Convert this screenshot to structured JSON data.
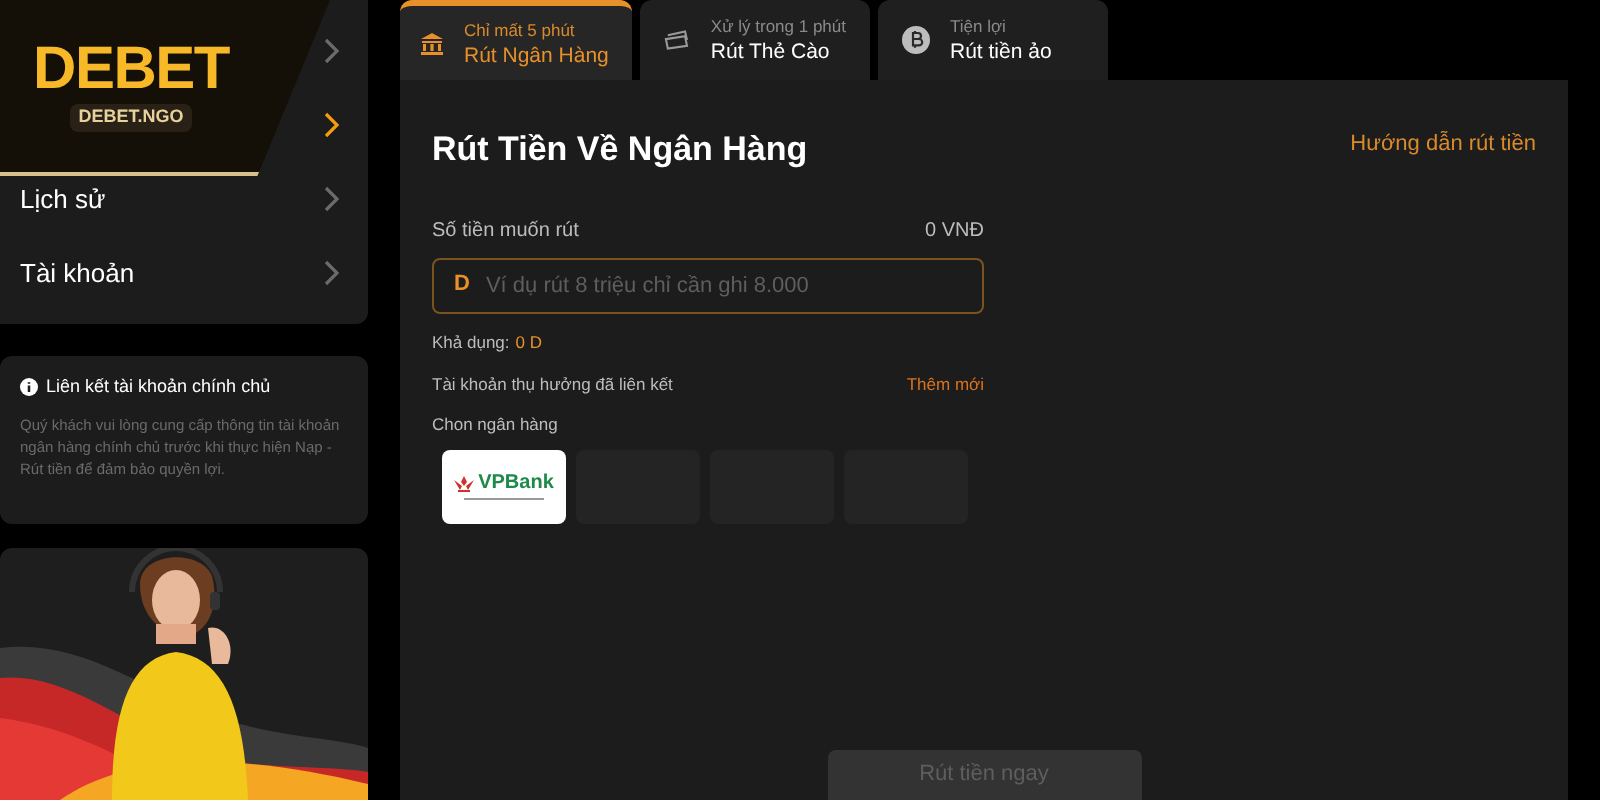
{
  "logo": {
    "name": "DEBET",
    "domain": "DEBET.NGO"
  },
  "menu": [
    {
      "selected": false
    },
    {
      "selected": true
    },
    {
      "label": "Lịch sử",
      "selected": false
    },
    {
      "label": "Tài khoản",
      "selected": false
    }
  ],
  "info_card": {
    "title": "Liên kết tài khoản chính chủ",
    "body": "Quý khách vui lòng cung cấp thông tin tài khoản ngân hàng chính chủ trước khi thực hiện Nạp - Rút tiền để đảm bảo quyền lợi."
  },
  "tabs": [
    {
      "caption": "Chỉ mất 5 phút",
      "label": "Rút Ngân Hàng",
      "selected": true
    },
    {
      "caption": "Xử lý trong 1 phút",
      "label": "Rút Thẻ Cào",
      "selected": false
    },
    {
      "caption": "Tiện lợi",
      "label": "Rút tiền ảo",
      "selected": false
    }
  ],
  "title": "Rút Tiền Về Ngân Hàng",
  "guide_link": "Hướng dẫn rút tiền",
  "amount": {
    "label": "Số tiền muốn rút",
    "value": "0 VNĐ",
    "prefix": "D",
    "placeholder": "Ví dụ rút 8 triệu chỉ cần ghi 8.000"
  },
  "available": {
    "label": "Khả dụng:",
    "value": "0 D"
  },
  "linked_accounts": {
    "label": "Tài khoản thụ hưởng đã liên kết",
    "action": "Thêm mới"
  },
  "bank_picker": {
    "label": "Chon ngân hàng",
    "banks": [
      {
        "kind": "logo",
        "name": "VPBank"
      },
      {
        "kind": "empty"
      },
      {
        "kind": "empty"
      },
      {
        "kind": "empty"
      }
    ]
  },
  "submit": {
    "label": "Rút tiền ngay",
    "disabled": true
  }
}
